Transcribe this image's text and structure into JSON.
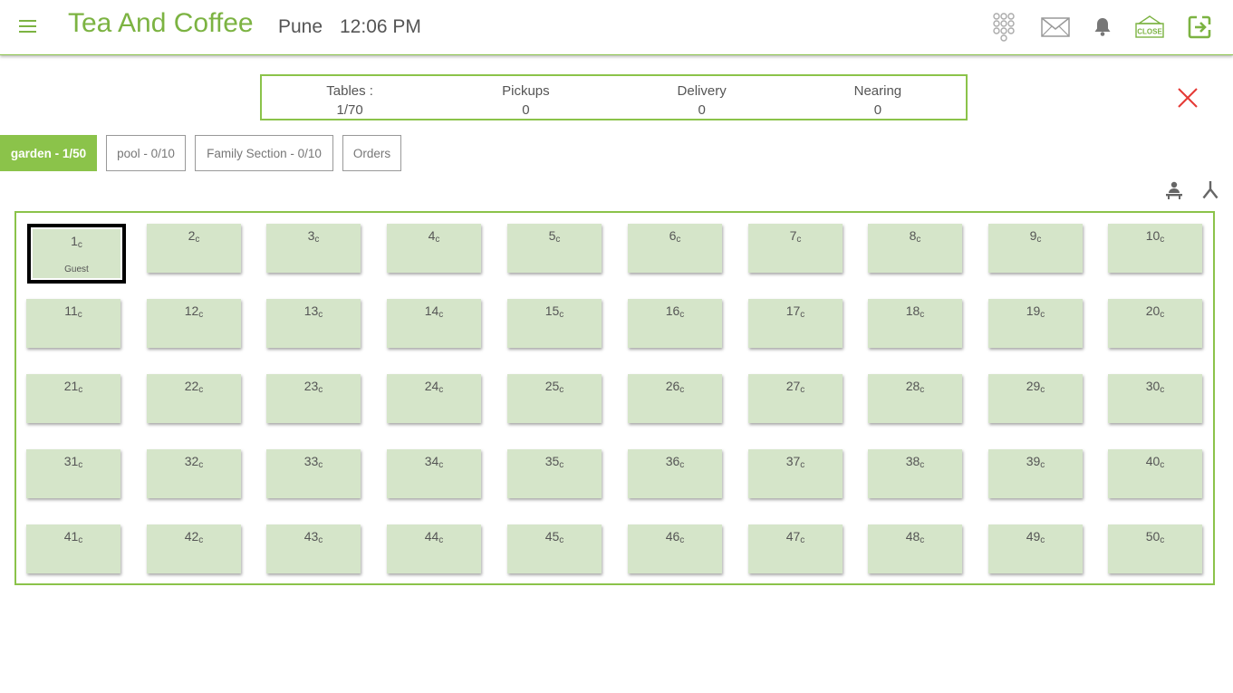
{
  "header": {
    "menu_icon": "hamburger-menu-icon",
    "brand": "Tea And Coffee",
    "city": "Pune",
    "time": "12:06 PM",
    "icons": [
      "keypad-icon",
      "mail-icon",
      "bell-icon",
      "close-day-icon",
      "logout-icon"
    ],
    "close_day_label": "CLOSE",
    "accent": "#7cb342"
  },
  "stats": [
    {
      "label": "Tables :",
      "value": "1/70"
    },
    {
      "label": "Pickups",
      "value": "0"
    },
    {
      "label": "Delivery",
      "value": "0"
    },
    {
      "label": "Nearing",
      "value": "0"
    }
  ],
  "sections": [
    {
      "label": "garden - 1/50",
      "active": true
    },
    {
      "label": "pool - 0/10",
      "active": false
    },
    {
      "label": "Family Section - 0/10",
      "active": false
    },
    {
      "label": "Orders",
      "active": false
    }
  ],
  "tools": [
    "person-table-icon",
    "split-merge-icon"
  ],
  "table_suffix": "c",
  "tables": [
    {
      "num": "1",
      "status": "Guest",
      "selected": true
    },
    {
      "num": "2"
    },
    {
      "num": "3"
    },
    {
      "num": "4"
    },
    {
      "num": "5"
    },
    {
      "num": "6"
    },
    {
      "num": "7"
    },
    {
      "num": "8"
    },
    {
      "num": "9"
    },
    {
      "num": "10"
    },
    {
      "num": "11"
    },
    {
      "num": "12"
    },
    {
      "num": "13"
    },
    {
      "num": "14"
    },
    {
      "num": "15"
    },
    {
      "num": "16"
    },
    {
      "num": "17"
    },
    {
      "num": "18"
    },
    {
      "num": "19"
    },
    {
      "num": "20"
    },
    {
      "num": "21"
    },
    {
      "num": "22"
    },
    {
      "num": "23"
    },
    {
      "num": "24"
    },
    {
      "num": "25"
    },
    {
      "num": "26"
    },
    {
      "num": "27"
    },
    {
      "num": "28"
    },
    {
      "num": "29"
    },
    {
      "num": "30"
    },
    {
      "num": "31"
    },
    {
      "num": "32"
    },
    {
      "num": "33"
    },
    {
      "num": "34"
    },
    {
      "num": "35"
    },
    {
      "num": "36"
    },
    {
      "num": "37"
    },
    {
      "num": "38"
    },
    {
      "num": "39"
    },
    {
      "num": "40"
    },
    {
      "num": "41"
    },
    {
      "num": "42"
    },
    {
      "num": "43"
    },
    {
      "num": "44"
    },
    {
      "num": "45"
    },
    {
      "num": "46"
    },
    {
      "num": "47"
    },
    {
      "num": "48"
    },
    {
      "num": "49"
    },
    {
      "num": "50"
    }
  ],
  "colors": {
    "accent": "#8bc34a",
    "table_bg": "#d5e5c9",
    "close": "#e53935"
  }
}
